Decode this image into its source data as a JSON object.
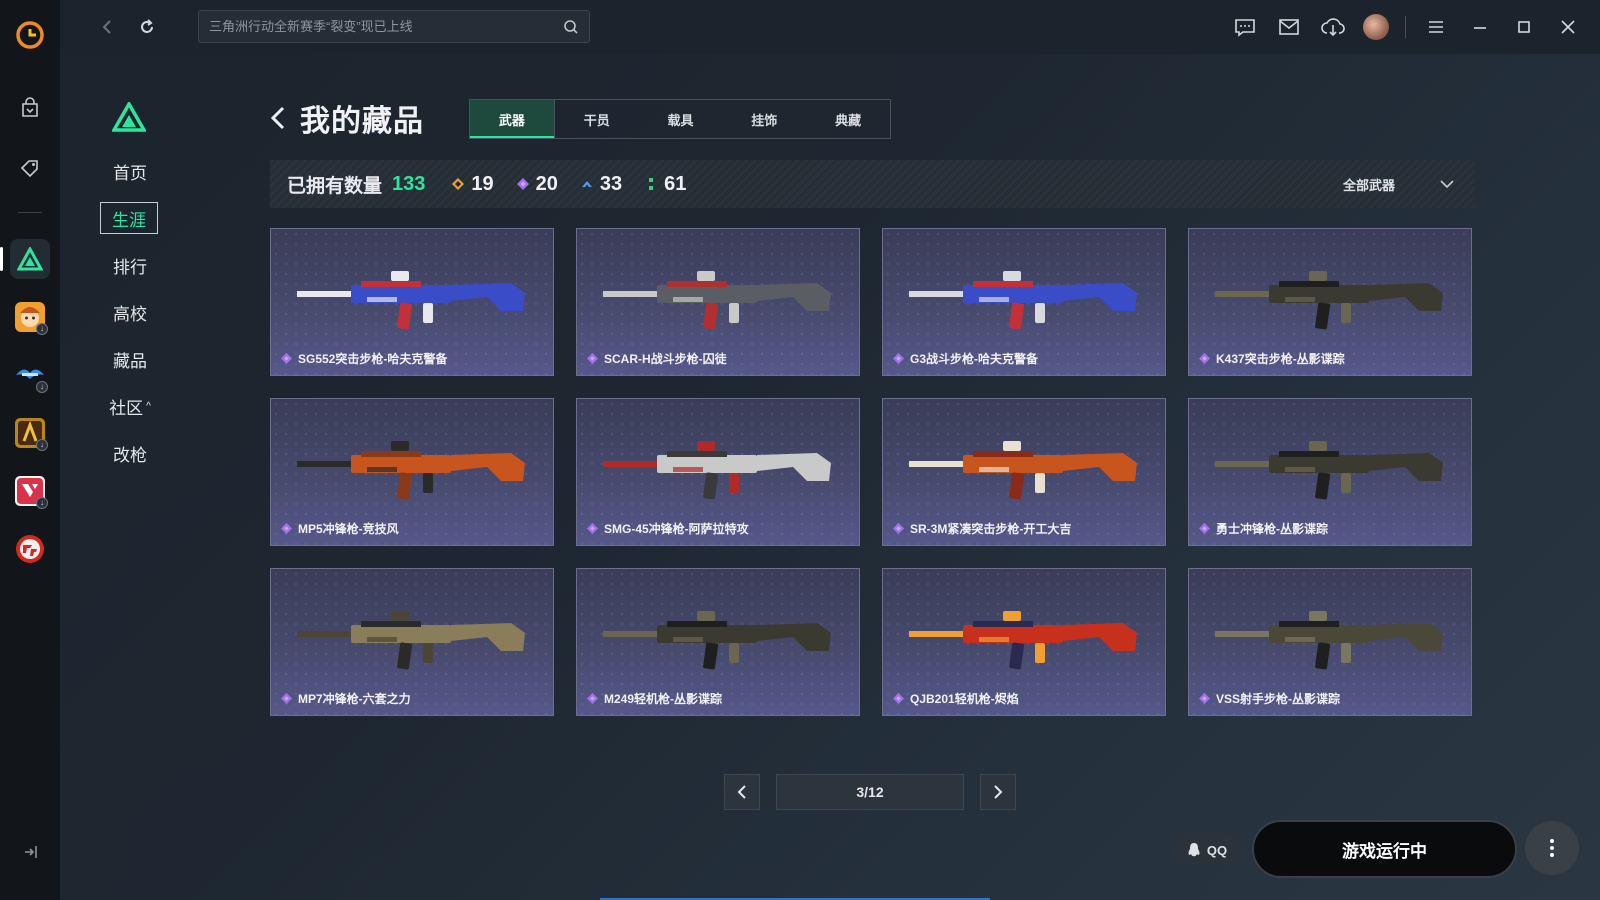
{
  "search": {
    "placeholder": "三角洲行动全新赛季“裂变”现已上线"
  },
  "sidenav": {
    "items": [
      {
        "label": "首页"
      },
      {
        "label": "生涯"
      },
      {
        "label": "排行"
      },
      {
        "label": "高校"
      },
      {
        "label": "藏品"
      },
      {
        "label": "社区"
      },
      {
        "label": "改枪"
      }
    ],
    "active_index": 1
  },
  "page": {
    "title": "我的藏品",
    "tabs": [
      {
        "label": "武器"
      },
      {
        "label": "干员"
      },
      {
        "label": "载具"
      },
      {
        "label": "挂饰"
      },
      {
        "label": "典藏"
      }
    ],
    "active_tab": 0
  },
  "stats": {
    "label": "已拥有数量",
    "total": "133",
    "rarities": [
      {
        "count": "19",
        "color": "#f0a030"
      },
      {
        "count": "20",
        "color": "#a56ff0"
      },
      {
        "count": "33",
        "color": "#4aa0f0"
      },
      {
        "count": "61",
        "color": "#36d07a"
      }
    ],
    "filter": "全部武器"
  },
  "items": [
    {
      "name": "SG552突击步枪-哈夫克警备",
      "palette": [
        "#3b4cc8",
        "#e8e8ee",
        "#c2303a"
      ]
    },
    {
      "name": "SCAR-H战斗步枪-囚徒",
      "palette": [
        "#5a5d63",
        "#c9c9c9",
        "#b03030"
      ]
    },
    {
      "name": "G3战斗步枪-哈夫克警备",
      "palette": [
        "#3b4cc8",
        "#d9d9e2",
        "#c2303a"
      ]
    },
    {
      "name": "K437突击步枪-丛影谍踪",
      "palette": [
        "#3b3a30",
        "#6a6650",
        "#1f1f1f"
      ]
    },
    {
      "name": "MP5冲锋枪-竞技风",
      "palette": [
        "#c8541e",
        "#2a2a2a",
        "#8a3a18"
      ]
    },
    {
      "name": "SMG-45冲锋枪-阿萨拉特攻",
      "palette": [
        "#c9c9c9",
        "#b02a2a",
        "#3a3a3a"
      ]
    },
    {
      "name": "SR-3M紧凑突击步枪-开工大吉",
      "palette": [
        "#c8541e",
        "#e8e0d0",
        "#8a2a18"
      ]
    },
    {
      "name": "勇士冲锋枪-丛影谍踪",
      "palette": [
        "#3b3a30",
        "#6a6650",
        "#1f1f1f"
      ]
    },
    {
      "name": "MP7冲锋枪-六套之力",
      "palette": [
        "#8a7e5a",
        "#4a4535",
        "#2a2a2a"
      ]
    },
    {
      "name": "M249轻机枪-丛影谍踪",
      "palette": [
        "#3b3a30",
        "#6a6650",
        "#1f1f1f"
      ]
    },
    {
      "name": "QJB201轻机枪-烬焰",
      "palette": [
        "#c8301e",
        "#f0a030",
        "#2a2a50"
      ]
    },
    {
      "name": "VSS射手步枪-丛影谍踪",
      "palette": [
        "#4a4838",
        "#7a7660",
        "#1f1f1f"
      ]
    }
  ],
  "pager": {
    "current": "3/12"
  },
  "footer": {
    "qq_label": "QQ",
    "launch_label": "游戏运行中"
  },
  "colors": {
    "accent": "#2ee59d",
    "rare_diamond": "#a56ff0"
  },
  "icons": {
    "rail": [
      "app-logo-icon",
      "shop-bag-icon",
      "tag-icon",
      "delta-force-icon",
      "game-avatar-icon",
      "game-wing-icon",
      "game-warrior-icon",
      "game-valorant-icon",
      "crossfire-icon"
    ],
    "top": [
      "back-icon",
      "refresh-icon",
      "search-icon",
      "message-icon",
      "mail-icon",
      "download-icon",
      "menu-icon",
      "minimize-icon",
      "maximize-icon",
      "close-icon"
    ]
  }
}
